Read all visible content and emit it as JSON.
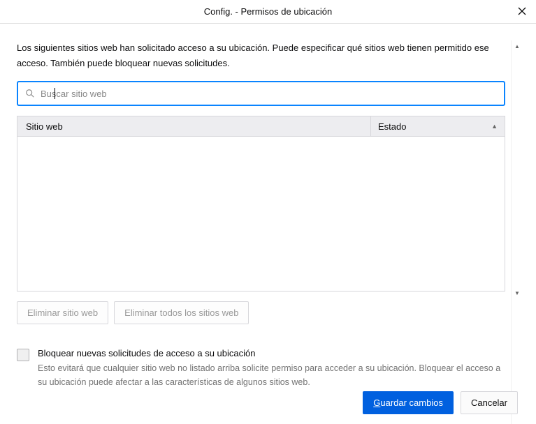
{
  "titlebar": {
    "title": "Config. - Permisos de ubicación"
  },
  "intro": "Los siguientes sitios web han solicitado acceso a su ubicación. Puede especificar qué sitios web tienen permitido ese acceso. También puede bloquear nuevas solicitudes.",
  "search": {
    "placeholder": "Buscar sitio web"
  },
  "table": {
    "col_site": "Sitio web",
    "col_status": "Estado",
    "rows": []
  },
  "buttons": {
    "remove_site": "Eliminar sitio web",
    "remove_all": "Eliminar todos los sitios web",
    "save": "Guardar cambios",
    "save_accesskey": "G",
    "cancel": "Cancelar"
  },
  "block": {
    "label": "Bloquear nuevas solicitudes de acceso a su ubicación",
    "description": "Esto evitará que cualquier sitio web no listado arriba solicite permiso para acceder a su ubicación. Bloquear el acceso a su ubicación puede afectar a las características de algunos sitios web."
  }
}
